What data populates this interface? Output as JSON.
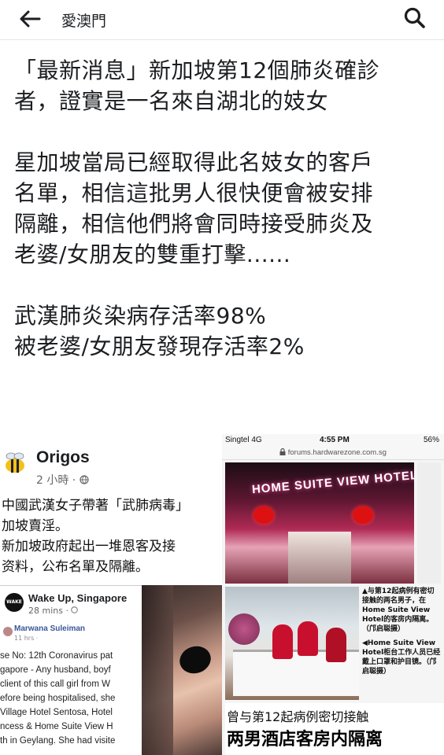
{
  "header": {
    "title": "愛澳門",
    "back_icon": "arrow-left-icon",
    "search_icon": "search-icon"
  },
  "post": {
    "paragraphs": [
      [
        "「最新消息」新加坡第12個肺炎確診",
        "者，證實是一名來自湖北的妓女"
      ],
      [
        "星加坡當局已經取得此名妓女的客戶",
        "名單，相信這批男人很快便會被安排",
        "隔離，相信他們將會同時接受肺炎及",
        "老婆/女朋友的雙重打擊......"
      ],
      [
        "武漢肺炎染病存活率98%",
        "被老婆/女朋友發現存活率2%"
      ]
    ]
  },
  "collage": {
    "fb_card": {
      "name": "Origos",
      "meta": "2 小時 · ",
      "body_lines": [
        "中國武漢女子帶著「武肺病毒」",
        "加坡賣淫。",
        "新加坡政府起出一堆恩客及接",
        "资料，公布名單及隔離。"
      ]
    },
    "inner_card": {
      "logo": "WAKE UP",
      "name": "Wake Up, Singapore",
      "meta": "28 mins · ",
      "commenter": "Marwana Suleiman",
      "comment_time": "11 hrs · ",
      "body_lines": [
        "se No: 12th Coronavirus pat",
        "gapore - Any husband, boyf",
        "client of this call girl from W",
        "efore being hospitalised, she",
        "Village Hotel Sentosa, Hotel",
        "ncess & Home Suite View H",
        "th in Geylang. She had visite"
      ]
    },
    "phone": {
      "carrier": "Singtel  4G",
      "time": "4:55 PM",
      "battery": "56%",
      "url": "forums.hardwarezone.com.sg",
      "hotel_sign": "HOME SUITE VIEW HOTEL",
      "caption_lines": [
        "▲与第12起病例有密切接触的两名男子，在Home Suite View Hotel的客房内隔离。（邝启聪摄）",
        "◀Home Suite View Hotel柜台工作人员已经戴上口罩和护目镜。（邝启聪摄）"
      ],
      "headline_small": "曾与第12起病例密切接触",
      "headline_big": "两男酒店客房内隔离"
    }
  }
}
